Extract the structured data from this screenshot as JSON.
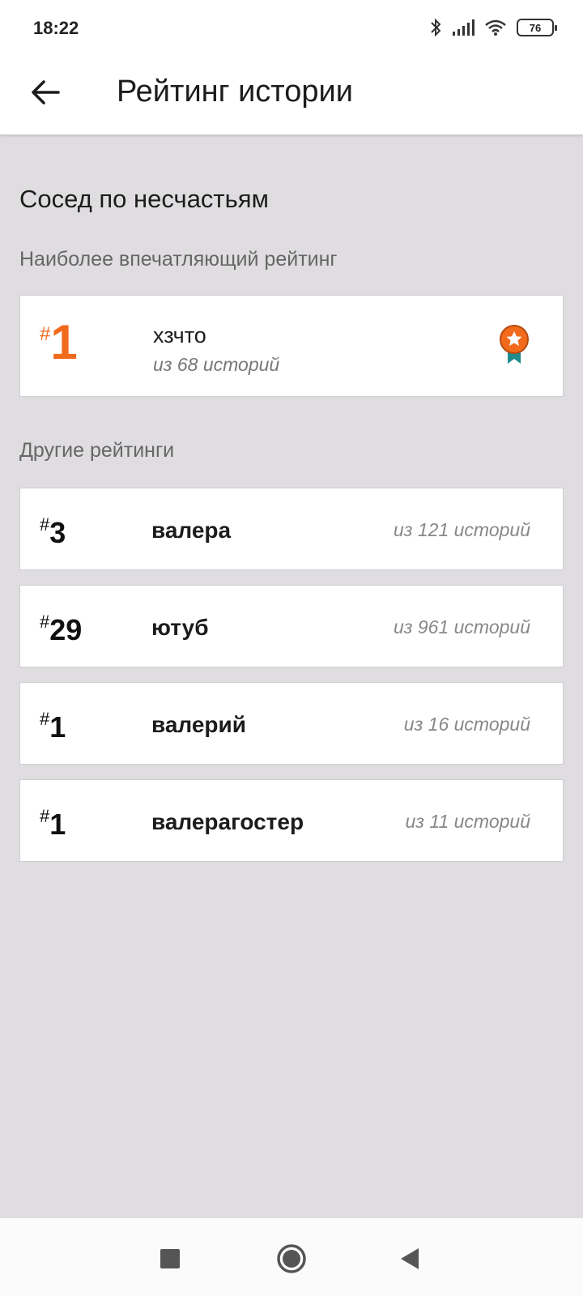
{
  "status_bar": {
    "time": "18:22",
    "battery": "76",
    "icons": [
      "bluetooth-icon",
      "signal-icon",
      "wifi-icon",
      "battery-icon"
    ]
  },
  "app_bar": {
    "back_icon": "arrow-left-icon",
    "title": "Рейтинг истории"
  },
  "story": {
    "title": "Сосед по несчастьям"
  },
  "best_section": {
    "label": "Наиболее впечатляющий рейтинг",
    "hash": "#",
    "rank": "1",
    "name": "хзчто",
    "total": "из 68 историй",
    "badge_icon": "award-ribbon-icon"
  },
  "other_section": {
    "label": "Другие рейтинги",
    "items": [
      {
        "hash": "#",
        "rank": "3",
        "name": "валера",
        "total": "из 121 историй"
      },
      {
        "hash": "#",
        "rank": "29",
        "name": "ютуб",
        "total": "из 961 историй"
      },
      {
        "hash": "#",
        "rank": "1",
        "name": "валерий",
        "total": "из 16 историй"
      },
      {
        "hash": "#",
        "rank": "1",
        "name": "валерагостер",
        "total": "из 11 историй"
      }
    ]
  },
  "nav_bar": {
    "icons": [
      "recents-square-icon",
      "home-circle-icon",
      "back-triangle-icon"
    ]
  },
  "colors": {
    "accent": "#f26a1b",
    "background": "#dfdde0",
    "badge_ribbon": "#1e8c8c"
  }
}
